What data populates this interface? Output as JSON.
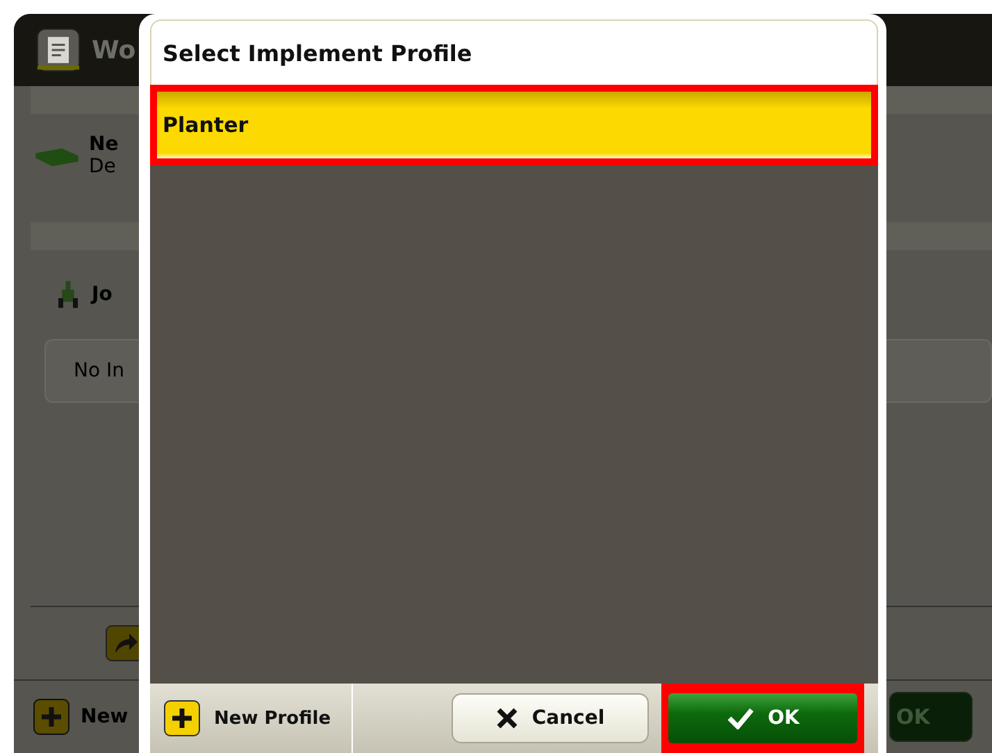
{
  "background": {
    "header_title": "Wo",
    "implement": {
      "name": "Ne",
      "detail": "De"
    },
    "job": {
      "name": "Jo",
      "status": "No In"
    },
    "footer_button": "New",
    "ok_button": "OK"
  },
  "dialog": {
    "title": "Select Implement Profile",
    "profiles": [
      {
        "label": "Planter",
        "selected": true,
        "highlighted": true
      }
    ],
    "buttons": [
      {
        "kind": "new",
        "label": "New Profile",
        "highlighted": false
      },
      {
        "kind": "cancel",
        "label": "Cancel",
        "highlighted": false
      },
      {
        "kind": "ok",
        "label": "OK",
        "highlighted": true
      }
    ]
  }
}
